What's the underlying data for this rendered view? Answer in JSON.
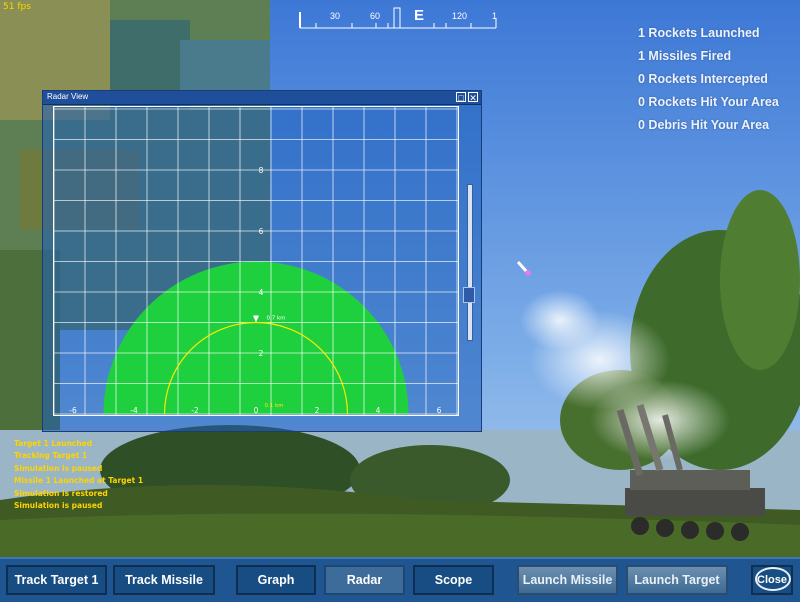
{
  "hud": {
    "fps": "51 fps",
    "compass": {
      "ticks": [
        "30",
        "60",
        "E",
        "120",
        "1"
      ]
    },
    "stats": [
      "1 Rockets Launched",
      "1 Missiles Fired",
      "0 Rockets Intercepted",
      "0 Rockets Hit Your Area",
      "0 Debris Hit Your Area"
    ]
  },
  "radar": {
    "title": "Radar View",
    "x_ticks": [
      "-6",
      "-4",
      "-2",
      "0",
      "2",
      "4",
      "6"
    ],
    "y_ticks": [
      "2",
      "4",
      "6",
      "8"
    ],
    "range_outer": "0.7 km",
    "range_inner": "0.1 km",
    "zoom_level": 0.73,
    "colors": {
      "coverage": "#1fd03e",
      "grid": "#ffffff",
      "range_ring": "#ffe800"
    }
  },
  "log": [
    "Target 1 Launched",
    "Tracking Target 1",
    "Simulation is paused",
    "Missile 1 Launched at Target 1",
    "Simulation is restored",
    "Simulation is paused"
  ],
  "toolbar": {
    "track_target": "Track Target 1",
    "track_missile": "Track Missile",
    "graph": "Graph",
    "radar": "Radar",
    "scope": "Scope",
    "launch_missile": "Launch Missile",
    "launch_target": "Launch Target",
    "close": "Close"
  }
}
